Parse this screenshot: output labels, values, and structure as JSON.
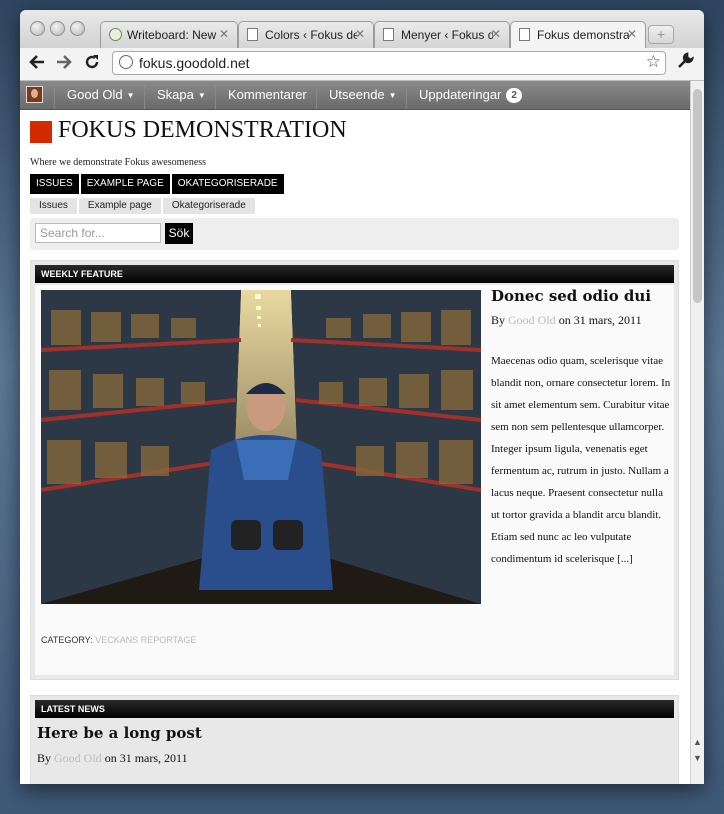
{
  "browser": {
    "tabs": [
      {
        "label": "Writeboard: New",
        "icon": "writeboard-favicon-icon"
      },
      {
        "label": "Colors ‹ Fokus de",
        "icon": "page-icon"
      },
      {
        "label": "Menyer ‹ Fokus d",
        "icon": "page-icon"
      },
      {
        "label": "Fokus demonstra",
        "icon": "page-icon",
        "active": true
      }
    ],
    "url": "fokus.goodold.net",
    "buttons": [
      "back-icon",
      "forward-icon",
      "reload-icon",
      "star-icon",
      "wrench-icon"
    ]
  },
  "adminbar": {
    "items": [
      {
        "label": "Good Old",
        "dropdown": true
      },
      {
        "label": "Skapa",
        "dropdown": true
      },
      {
        "label": "Kommentarer",
        "dropdown": false
      },
      {
        "label": "Utseende",
        "dropdown": true
      },
      {
        "label": "Uppdateringar",
        "badge": "2"
      }
    ]
  },
  "site": {
    "title": "FOKUS DEMONSTRATION",
    "tagline": "Where we demonstrate Fokus awesomeness",
    "accent": "#d52a00",
    "mainnav": [
      "ISSUES",
      "EXAMPLE PAGE",
      "OKATEGORISERADE"
    ],
    "subnav": [
      "Issues",
      "Example page",
      "Okategoriserade"
    ],
    "search": {
      "placeholder": "Search for...",
      "button": "Sök"
    }
  },
  "feature": {
    "heading": "WEEKLY FEATURE",
    "post_title": "Donec sed odio dui",
    "by": "By",
    "author": "Good Old",
    "date": "on 31 mars, 2011",
    "excerpt": "Maecenas odio quam, scelerisque vitae blandit non, ornare consectetur lorem. In sit amet elementum sem. Curabitur vitae sem non sem pellentesque ullamcorper. Integer ipsum ligula, venenatis eget fermentum ac, rutrum in justo. Nullam a lacus neque. Praesent consectetur nulla ut tortor gravida a blandit arcu blandit. Etiam sed nunc ac leo vulputate condimentum id scelerisque [...]",
    "category_label": "CATEGORY:",
    "category": "VECKANS REPORTAGE"
  },
  "latest": {
    "heading": "LATEST NEWS",
    "post_title": "Here be a long post",
    "by": "By",
    "author": "Good Old",
    "date": "on 31 mars, 2011"
  }
}
